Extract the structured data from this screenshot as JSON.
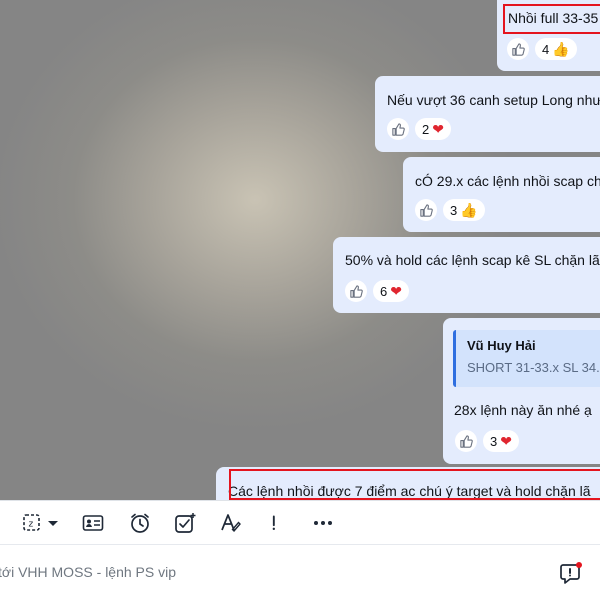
{
  "messages": [
    {
      "text": "Nhồi full 33-35",
      "reaction_count": "4",
      "reaction": "thumbs-up",
      "highlighted": true
    },
    {
      "text": "Nếu vượt 36 canh setup Long như",
      "reaction_count": "2",
      "reaction": "heart",
      "highlighted": false
    },
    {
      "text": "cÓ 29.x các lệnh nhồi scap ch",
      "reaction_count": "3",
      "reaction": "thumbs-up",
      "highlighted": false
    },
    {
      "text": "50% và hold các lệnh scap kê SL chặn lã",
      "reaction_count": "6",
      "reaction": "heart",
      "highlighted": false
    },
    {
      "quote_author": "Vũ Huy Hải",
      "quote_text": "SHORT 31-33.x SL 34.",
      "text": "28x lệnh này ăn nhé ạ",
      "reaction_count": "3",
      "reaction": "heart",
      "highlighted": false
    },
    {
      "text": "Các lệnh nhồi được 7 điểm ac chú ý target và hold chặn lã",
      "highlighted": true
    }
  ],
  "toolbar": {
    "tools": [
      "screenshot-icon",
      "dropdown-arrow-icon",
      "contact-card-icon",
      "reminder-clock-icon",
      "task-check-icon",
      "text-format-icon",
      "important-mark-icon",
      "more-icon"
    ]
  },
  "composer": {
    "placeholder": "tới VHH MOSS - lệnh PS vip"
  },
  "colors": {
    "bubble": "#e4ecfd",
    "highlight_border": "#e4141e",
    "quote_bar": "#2f6fe0",
    "heart": "#e0262f",
    "thumb": "#f4b000"
  }
}
